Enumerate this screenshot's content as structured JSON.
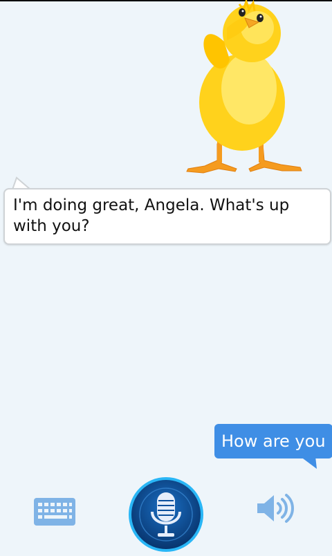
{
  "conversation": {
    "bot_message": "I'm doing great, Angela. What's up with you?",
    "user_message": "How are you"
  },
  "colors": {
    "background": "#eef5fa",
    "user_bubble": "#3f8ee5",
    "mic_button": "#0b4f9c",
    "mic_ring": "#29b6f6",
    "control_icon": "#7fb3e6",
    "chick_yellow": "#ffd21c",
    "chick_feet": "#f39a1e"
  },
  "icons": {
    "keyboard": "keyboard-icon",
    "microphone": "microphone-icon",
    "speaker": "speaker-icon",
    "character": "chick-character"
  }
}
